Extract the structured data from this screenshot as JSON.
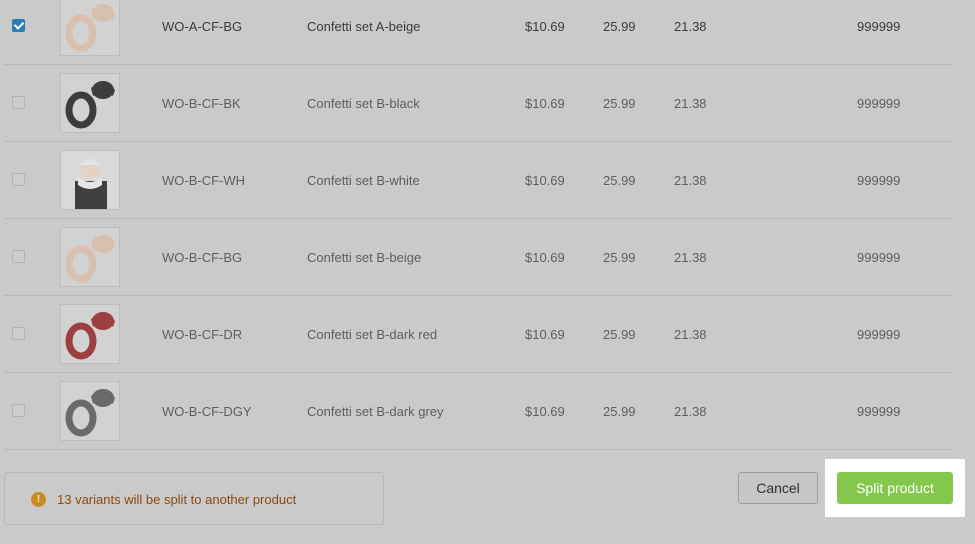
{
  "variants": [
    {
      "checked": true,
      "sku": "WO-A-CF-BG",
      "name": "Confetti set A-beige",
      "cost": "$10.69",
      "price": "25.99",
      "compare_price": "21.38",
      "quantity": "999999",
      "thumb_color": "#d8bfae",
      "thumb_icon": "hat-scarf-beige-icon"
    },
    {
      "checked": false,
      "sku": "WO-B-CF-BK",
      "name": "Confetti set B-black",
      "cost": "$10.69",
      "price": "25.99",
      "compare_price": "21.38",
      "quantity": "999999",
      "thumb_color": "#3c3c3c",
      "thumb_icon": "hat-scarf-black-icon"
    },
    {
      "checked": false,
      "sku": "WO-B-CF-WH",
      "name": "Confetti set B-white",
      "cost": "$10.69",
      "price": "25.99",
      "compare_price": "21.38",
      "quantity": "999999",
      "thumb_color": "#e6e6e6",
      "thumb_icon": "model-white-set-icon"
    },
    {
      "checked": false,
      "sku": "WO-B-CF-BG",
      "name": "Confetti set B-beige",
      "cost": "$10.69",
      "price": "25.99",
      "compare_price": "21.38",
      "quantity": "999999",
      "thumb_color": "#d8bfae",
      "thumb_icon": "hat-scarf-beige-icon"
    },
    {
      "checked": false,
      "sku": "WO-B-CF-DR",
      "name": "Confetti set B-dark red",
      "cost": "$10.69",
      "price": "25.99",
      "compare_price": "21.38",
      "quantity": "999999",
      "thumb_color": "#9b3f40",
      "thumb_icon": "hat-scarf-darkred-icon"
    },
    {
      "checked": false,
      "sku": "WO-B-CF-DGY",
      "name": "Confetti set B-dark grey",
      "cost": "$10.69",
      "price": "25.99",
      "compare_price": "21.38",
      "quantity": "999999",
      "thumb_color": "#6a6a6a",
      "thumb_icon": "hat-scarf-darkgrey-icon"
    }
  ],
  "notice": {
    "message": "13 variants will be split to another product",
    "icon": "warning-icon",
    "icon_glyph": "!"
  },
  "actions": {
    "cancel_label": "Cancel",
    "split_label": "Split product"
  },
  "colors": {
    "accent_checkbox": "#2a7fb6",
    "split_button": "#83c84d",
    "warning": "#c98a26",
    "warning_text": "#8a4a12"
  }
}
